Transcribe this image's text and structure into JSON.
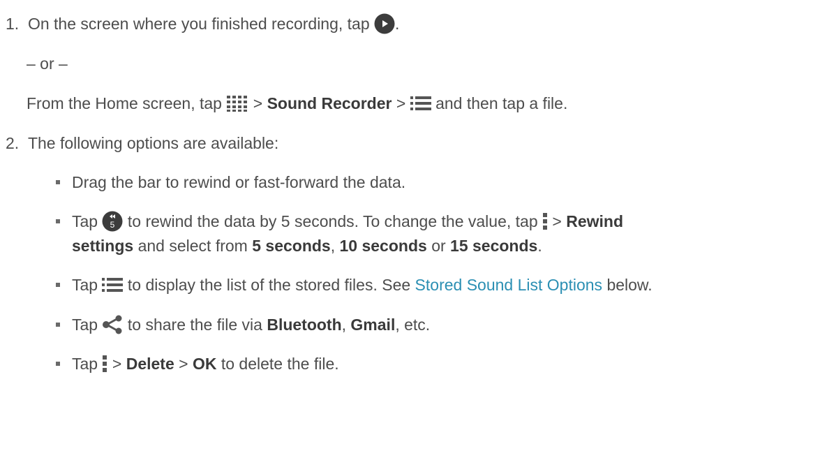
{
  "colors": {
    "text": "#4d4d4d",
    "link": "#2b8fb3",
    "icon_dark": "#3c3c3c",
    "icon_grey": "#555555"
  },
  "steps": [
    {
      "number": "1.",
      "text_a": "On the screen where you finished recording, tap",
      "icon": "play-button-icon",
      "text_b": ".",
      "or": "– or –",
      "alt": {
        "prefix": "From the Home screen, tap",
        "icon1": "apps-grid-icon",
        "sep1": ">",
        "bold1": "Sound Recorder",
        "sep2": ">",
        "icon2": "list-icon",
        "suffix": "and then tap a file."
      }
    },
    {
      "number": "2.",
      "text": "The following options are available:"
    }
  ],
  "options": [
    {
      "text": "Drag the bar to rewind or fast-forward the data."
    },
    {
      "tap": "Tap",
      "icon": "rewind-5-icon",
      "rewind_icon_number": "5",
      "text_a": "to rewind the data by 5 seconds. To change the value, tap",
      "icon2": "menu-icon",
      "sep": ">",
      "bold1": "Rewind",
      "bold1b": "settings",
      "text_b": "and select from",
      "bold2": "5 seconds",
      "comma": ",",
      "bold3": "10 seconds",
      "or": "or",
      "bold4": "15 seconds",
      "end": "."
    },
    {
      "tap": "Tap",
      "icon": "list-icon",
      "text_a": "to display the list of the stored files. See",
      "link": "Stored Sound List Options",
      "text_b": "below."
    },
    {
      "tap": "Tap",
      "icon": "share-icon",
      "text_a": "to share the file via",
      "bold1": "Bluetooth",
      "comma": ",",
      "bold2": "Gmail",
      "text_b": ", etc."
    },
    {
      "tap": "Tap",
      "icon": "menu-icon",
      "sep1": ">",
      "bold1": "Delete",
      "sep2": ">",
      "bold2": "OK",
      "text_b": "to delete the file."
    }
  ]
}
